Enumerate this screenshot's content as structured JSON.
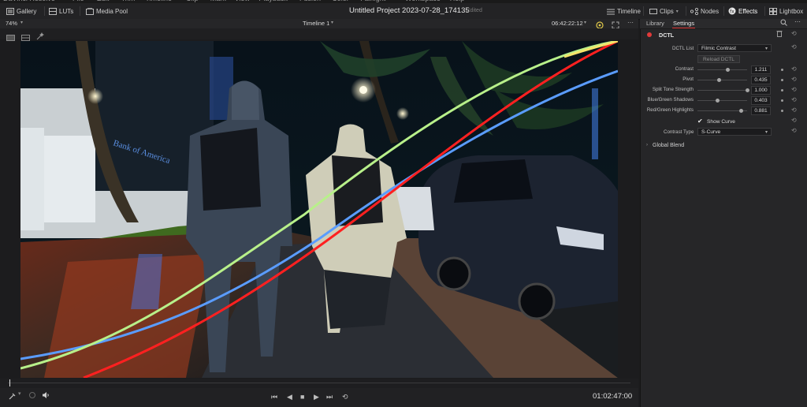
{
  "menu": [
    "DaVinci Resolve",
    "File",
    "Edit",
    "Trim",
    "Timeline",
    "Clip",
    "Mark",
    "View",
    "Playback",
    "Fusion",
    "Color",
    "Fairlight",
    "Workspace",
    "Help"
  ],
  "toolbar": {
    "gallery": "Gallery",
    "luts": "LUTs",
    "media_pool": "Media Pool",
    "project_title": "Untitled Project 2023-07-28_174135",
    "project_state": "Edited",
    "timeline": "Timeline",
    "clips": "Clips",
    "nodes": "Nodes",
    "effects": "Effects",
    "lightbox": "Lightbox"
  },
  "viewer": {
    "zoom": "74%",
    "timeline_name": "Timeline 1",
    "source_timecode": "06:42:22:12",
    "record_timecode": "01:02:47:00"
  },
  "panel": {
    "tab_library": "Library",
    "tab_settings": "Settings",
    "effect_name": "DCTL",
    "dctl_list_label": "DCTL List",
    "dctl_list_value": "Filmic Contrast",
    "reload_button": "Reload DCTL",
    "params": [
      {
        "label": "Contrast",
        "value": "1.211",
        "level": 0.61
      },
      {
        "label": "Pivot",
        "value": "0.435",
        "level": 0.44
      },
      {
        "label": "Split Tone Strength",
        "value": "1.000",
        "level": 1.0
      },
      {
        "label": "Blue/Green Shadows",
        "value": "0.403",
        "level": 0.4
      },
      {
        "label": "Red/Green Highlights",
        "value": "0.881",
        "level": 0.88
      }
    ],
    "show_curve_label": "Show Curve",
    "contrast_type_label": "Contrast Type",
    "contrast_type_value": "S-Curve",
    "global_blend": "Global Blend"
  },
  "colors": {
    "accent_red": "#e23a3a",
    "curve_red": "#ff2020",
    "curve_green": "#b8f08a",
    "curve_blue": "#5a9cff",
    "curve_yellow": "#f5e46a"
  }
}
